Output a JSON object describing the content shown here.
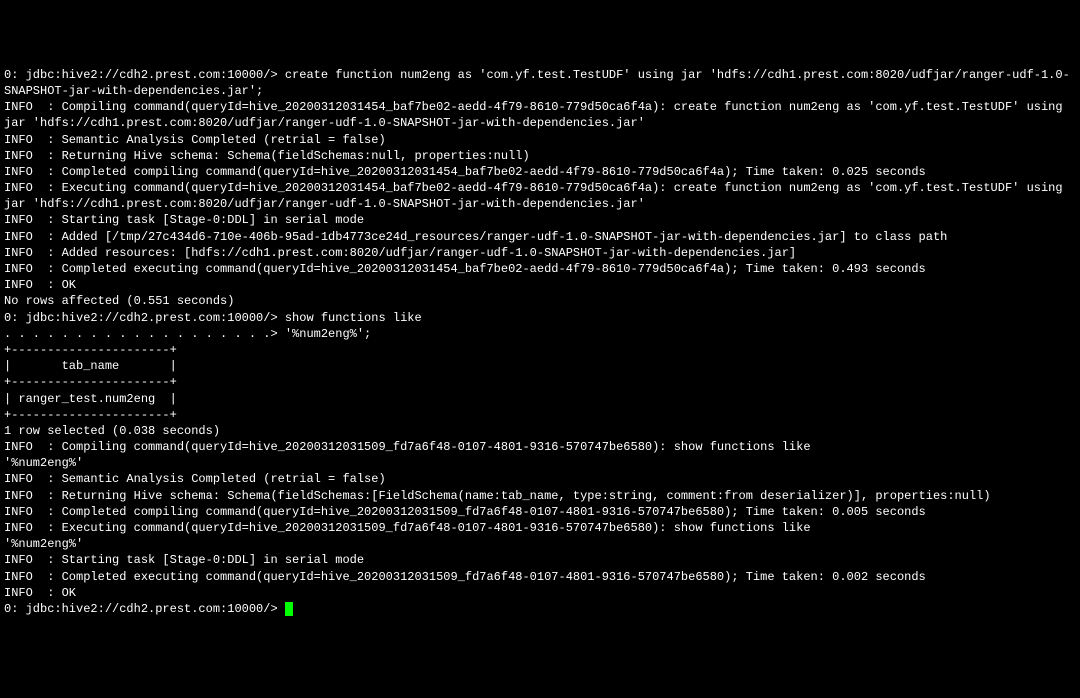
{
  "terminal": {
    "lines": [
      "0: jdbc:hive2://cdh2.prest.com:10000/> create function num2eng as 'com.yf.test.TestUDF' using jar 'hdfs://cdh1.prest.com:8020/udfjar/ranger-udf-1.0-SNAPSHOT-jar-with-dependencies.jar';",
      "INFO  : Compiling command(queryId=hive_20200312031454_baf7be02-aedd-4f79-8610-779d50ca6f4a): create function num2eng as 'com.yf.test.TestUDF' using jar 'hdfs://cdh1.prest.com:8020/udfjar/ranger-udf-1.0-SNAPSHOT-jar-with-dependencies.jar'",
      "INFO  : Semantic Analysis Completed (retrial = false)",
      "INFO  : Returning Hive schema: Schema(fieldSchemas:null, properties:null)",
      "INFO  : Completed compiling command(queryId=hive_20200312031454_baf7be02-aedd-4f79-8610-779d50ca6f4a); Time taken: 0.025 seconds",
      "INFO  : Executing command(queryId=hive_20200312031454_baf7be02-aedd-4f79-8610-779d50ca6f4a): create function num2eng as 'com.yf.test.TestUDF' using jar 'hdfs://cdh1.prest.com:8020/udfjar/ranger-udf-1.0-SNAPSHOT-jar-with-dependencies.jar'",
      "INFO  : Starting task [Stage-0:DDL] in serial mode",
      "INFO  : Added [/tmp/27c434d6-710e-406b-95ad-1db4773ce24d_resources/ranger-udf-1.0-SNAPSHOT-jar-with-dependencies.jar] to class path",
      "INFO  : Added resources: [hdfs://cdh1.prest.com:8020/udfjar/ranger-udf-1.0-SNAPSHOT-jar-with-dependencies.jar]",
      "INFO  : Completed executing command(queryId=hive_20200312031454_baf7be02-aedd-4f79-8610-779d50ca6f4a); Time taken: 0.493 seconds",
      "INFO  : OK",
      "No rows affected (0.551 seconds)",
      "0: jdbc:hive2://cdh2.prest.com:10000/> show functions like",
      ". . . . . . . . . . . . . . . . . . .> '%num2eng%';",
      "+----------------------+",
      "|       tab_name       |",
      "+----------------------+",
      "| ranger_test.num2eng  |",
      "+----------------------+",
      "1 row selected (0.038 seconds)",
      "INFO  : Compiling command(queryId=hive_20200312031509_fd7a6f48-0107-4801-9316-570747be6580): show functions like",
      "'%num2eng%'",
      "INFO  : Semantic Analysis Completed (retrial = false)",
      "INFO  : Returning Hive schema: Schema(fieldSchemas:[FieldSchema(name:tab_name, type:string, comment:from deserializer)], properties:null)",
      "INFO  : Completed compiling command(queryId=hive_20200312031509_fd7a6f48-0107-4801-9316-570747be6580); Time taken: 0.005 seconds",
      "INFO  : Executing command(queryId=hive_20200312031509_fd7a6f48-0107-4801-9316-570747be6580): show functions like",
      "'%num2eng%'",
      "INFO  : Starting task [Stage-0:DDL] in serial mode",
      "INFO  : Completed executing command(queryId=hive_20200312031509_fd7a6f48-0107-4801-9316-570747be6580); Time taken: 0.002 seconds",
      "INFO  : OK",
      "0: jdbc:hive2://cdh2.prest.com:10000/> "
    ]
  }
}
